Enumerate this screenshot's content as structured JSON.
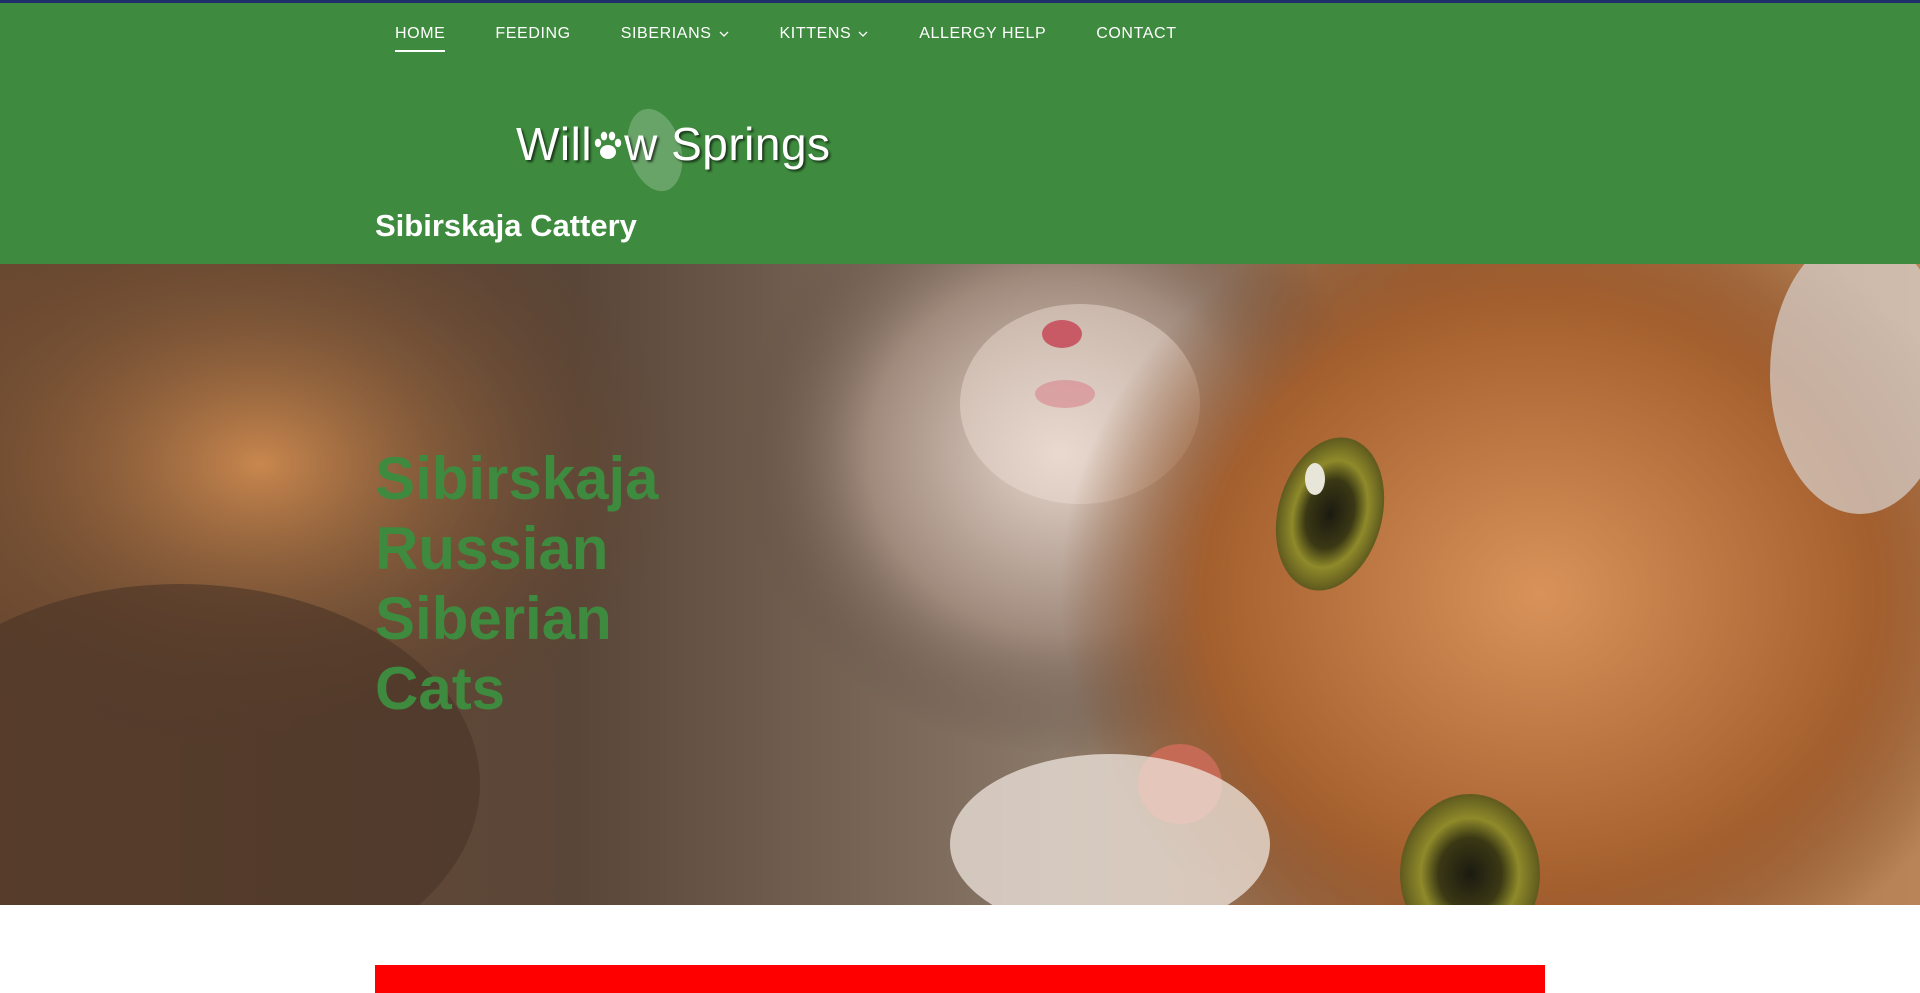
{
  "nav": {
    "items": [
      {
        "label": "HOME",
        "active": true,
        "has_dropdown": false
      },
      {
        "label": "FEEDING",
        "active": false,
        "has_dropdown": false
      },
      {
        "label": "SIBERIANS",
        "active": false,
        "has_dropdown": true
      },
      {
        "label": "KITTENS",
        "active": false,
        "has_dropdown": true
      },
      {
        "label": "ALLERGY HELP",
        "active": false,
        "has_dropdown": false
      },
      {
        "label": "CONTACT",
        "active": false,
        "has_dropdown": false
      }
    ]
  },
  "logo": {
    "text_before": "Will",
    "text_after": "w Springs"
  },
  "tagline": "Sibirskaja Cattery",
  "hero": {
    "title_lines": [
      "Sibirskaja",
      "Russian",
      "Siberian",
      "Cats"
    ]
  },
  "colors": {
    "header_bg": "#3e8a3e",
    "top_accent": "#1f2d6b",
    "hero_title": "#3e8a3e",
    "alert_bar": "#ff0000"
  }
}
